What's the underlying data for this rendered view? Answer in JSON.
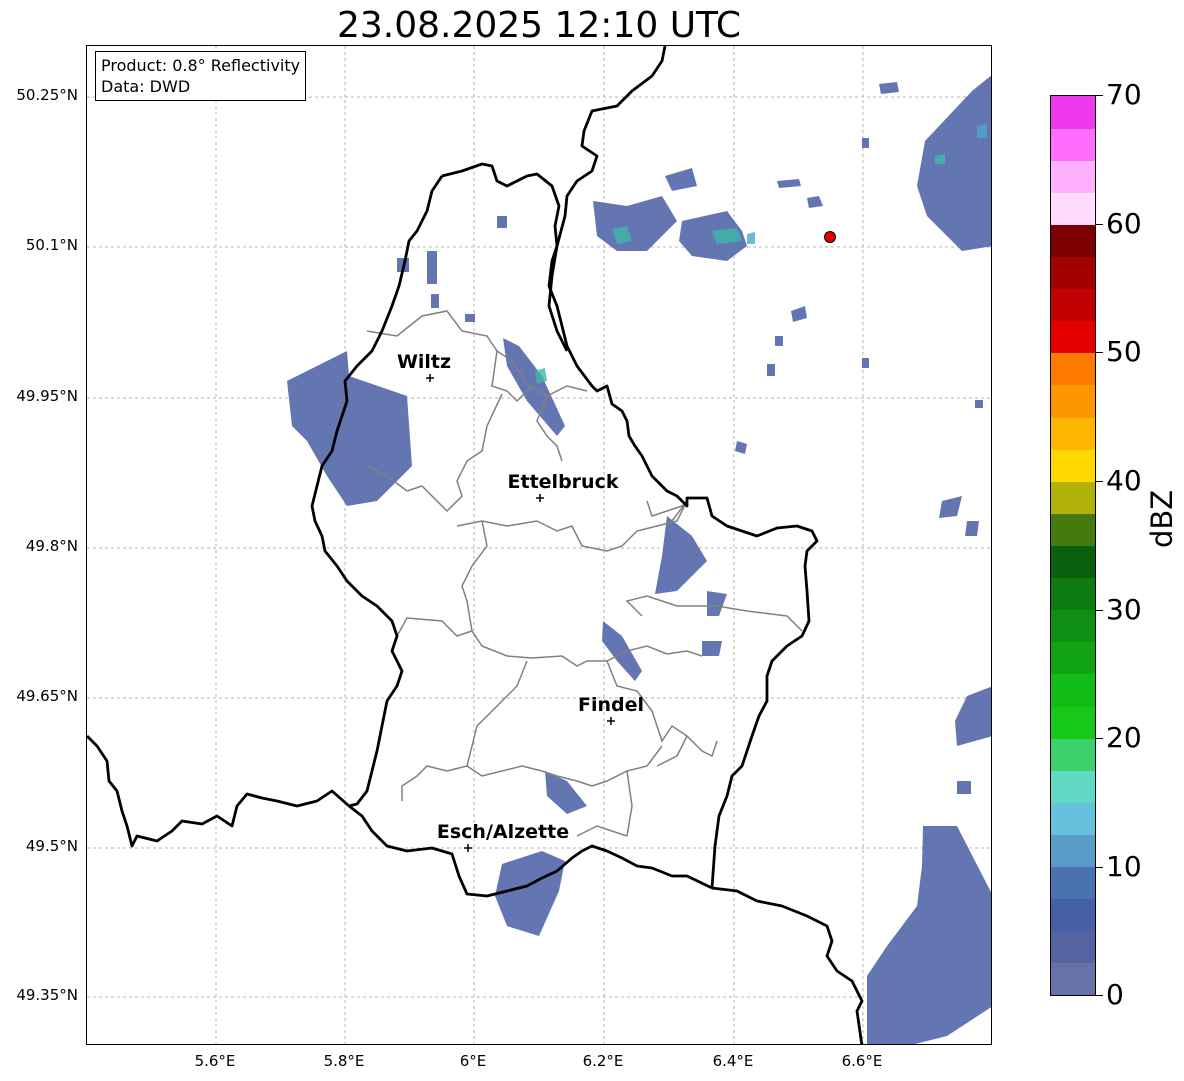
{
  "title": "23.08.2025 12:10 UTC",
  "info": {
    "product": "Product: 0.8° Reflectivity",
    "data": "Data: DWD"
  },
  "lat_labels": [
    "50.25°N",
    "50.1°N",
    "49.95°N",
    "49.8°N",
    "49.65°N",
    "49.5°N",
    "49.35°N"
  ],
  "lon_labels": [
    "5.6°E",
    "5.8°E",
    "6°E",
    "6.2°E",
    "6.4°E",
    "6.6°E"
  ],
  "cities": [
    {
      "name": "Wiltz"
    },
    {
      "name": "Ettelbruck"
    },
    {
      "name": "Findel"
    },
    {
      "name": "Esch/Alzette"
    }
  ],
  "colorbar": {
    "label": "dBZ",
    "ticks": [
      "70",
      "60",
      "50",
      "40",
      "30",
      "20",
      "10",
      "0"
    ],
    "colors": [
      "#6673a8",
      "#5563a0",
      "#4660a8",
      "#4a72b0",
      "#5a9cc8",
      "#66c2dc",
      "#62d9c4",
      "#3dd16a",
      "#15c81a",
      "#12bd18",
      "#11a514",
      "#0f8f13",
      "#0d7a12",
      "#0a600e",
      "#457a10",
      "#b0b308",
      "#fed800",
      "#fdb500",
      "#fd9600",
      "#fd7a00",
      "#e50000",
      "#c10000",
      "#a30000",
      "#7c0000",
      "#ffdcfc",
      "#ffb0fe",
      "#ff6cfe",
      "#ec39ef"
    ]
  },
  "marker_color": "#e00000"
}
